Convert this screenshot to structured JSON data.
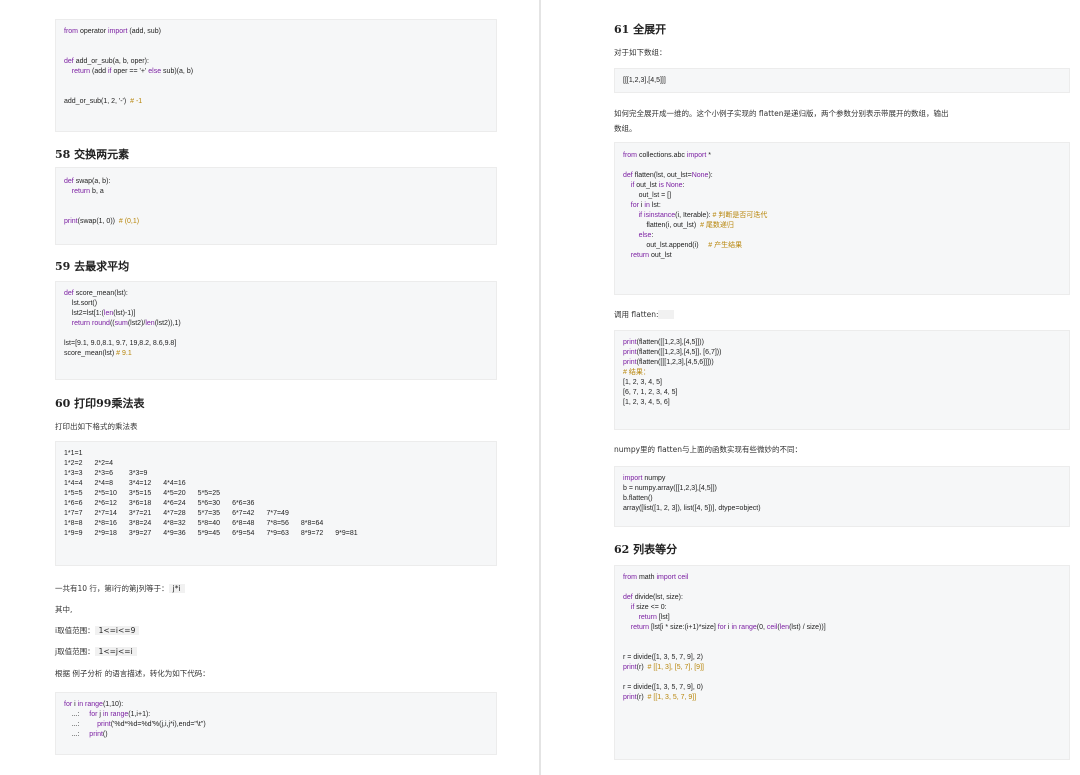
{
  "left": {
    "block1_lines": [
      "from operator import (add, sub)",
      "",
      "",
      "def add_or_sub(a, b, oper):",
      "    return (add if oper == '+' else sub)(a, b)",
      "",
      "",
      "add_or_sub(1, 2, '-')  # -1"
    ],
    "sec58_title": "58 交换两元素",
    "block2_lines": [
      "def swap(a, b):",
      "    return b, a",
      "",
      "",
      "print(swap(1, 0))  # (0,1)"
    ],
    "sec59_title": "59 去最求平均",
    "block3_lines": [
      "def score_mean(lst):",
      "    lst.sort()",
      "    lst2=lst[1:(len(lst)-1)]",
      "    return round((sum(lst2)/len(lst2)),1)",
      "",
      "lst=[9.1, 9.0,8.1, 9.7, 19,8.2, 8.6,9.8]",
      "score_mean(lst) # 9.1"
    ],
    "sec60_title": "60 打印99乘法表",
    "sec60_intro": "打印出如下格式的乘法表",
    "mult_rows": [
      [
        "1*1=1"
      ],
      [
        "1*2=2",
        "2*2=4"
      ],
      [
        "1*3=3",
        "2*3=6",
        "3*3=9"
      ],
      [
        "1*4=4",
        "2*4=8",
        "3*4=12",
        "4*4=16"
      ],
      [
        "1*5=5",
        "2*5=10",
        "3*5=15",
        "4*5=20",
        "5*5=25"
      ],
      [
        "1*6=6",
        "2*6=12",
        "3*6=18",
        "4*6=24",
        "5*6=30",
        "6*6=36"
      ],
      [
        "1*7=7",
        "2*7=14",
        "3*7=21",
        "4*7=28",
        "5*7=35",
        "6*7=42",
        "7*7=49"
      ],
      [
        "1*8=8",
        "2*8=16",
        "3*8=24",
        "4*8=32",
        "5*8=40",
        "6*8=48",
        "7*8=56",
        "8*8=64"
      ],
      [
        "1*9=9",
        "2*9=18",
        "3*9=27",
        "4*9=36",
        "5*9=45",
        "6*9=54",
        "7*9=63",
        "8*9=72",
        "9*9=81"
      ]
    ],
    "para_rows": "一共有10 行，第i行的第j列等于：",
    "para_rows_code": "j*i",
    "para_where": "其中,",
    "para_i_label": "i取值范围：",
    "para_i_code": "1<=i<=9",
    "para_j_label": "j取值范围：",
    "para_j_code": "1<=j<=i",
    "para_convert": "根据 例子分析 的语言描述，转化为如下代码：",
    "block5_lines": [
      "for i in range(1,10):",
      "    ...:     for j in range(1,i+1):",
      "    ...:         print('%d*%d=%d'%(j,i,j*i),end=\"\\t\")",
      "    ...:     print()"
    ]
  },
  "right": {
    "sec61_title": "61 全展开",
    "sec61_intro": "对于如下数组：",
    "array_example": "[[[1,2,3],[4,5]]]",
    "sec61_desc1": "如何完全展开成一维的。这个小例子实现的 flatten是递归版，两个参数分别表示带展开的数组，输出",
    "sec61_desc2": "数组。",
    "block6_lines": [
      "from collections.abc import *",
      "",
      "def flatten(lst, out_lst=None):",
      "    if out_lst is None:",
      "        out_lst = []",
      "    for i in lst:",
      "        if isinstance(i, Iterable): # 判断是否可迭代",
      "            flatten(i, out_lst)  # 尾数递归",
      "        else:",
      "            out_lst.append(i)     # 产生结果",
      "    return out_lst"
    ],
    "call_label": "调用 flatten:",
    "block7_lines": [
      "print(flatten([[1,2,3],[4,5]]))",
      "print(flatten([[1,2,3],[4,5]], [6,7]))",
      "print(flatten([[[1,2,3],[4,5,6]]]))",
      "# 结果：",
      "[1, 2, 3, 4, 5]",
      "[6, 7, 1, 2, 3, 4, 5]",
      "[1, 2, 3, 4, 5, 6]"
    ],
    "numpy_note": "numpy里的 flatten与上面的函数实现有些微妙的不同：",
    "block8_lines": [
      "import numpy",
      "b = numpy.array([[1,2,3],[4,5]])",
      "b.flatten()",
      "array([list([1, 2, 3]), list([4, 5])], dtype=object)"
    ],
    "sec62_title": "62 列表等分",
    "block9_lines": [
      "from math import ceil",
      "",
      "def divide(lst, size):",
      "    if size <= 0:",
      "        return [lst]",
      "    return [lst[i * size:(i+1)*size] for i in range(0, ceil(len(lst) / size))]",
      "",
      "",
      "r = divide([1, 3, 5, 7, 9], 2)",
      "print(r)  # [[1, 3], [5, 7], [9]]",
      "",
      "r = divide([1, 3, 5, 7, 9], 0)",
      "print(r)  # [[1, 3, 5, 7, 9]]"
    ]
  }
}
